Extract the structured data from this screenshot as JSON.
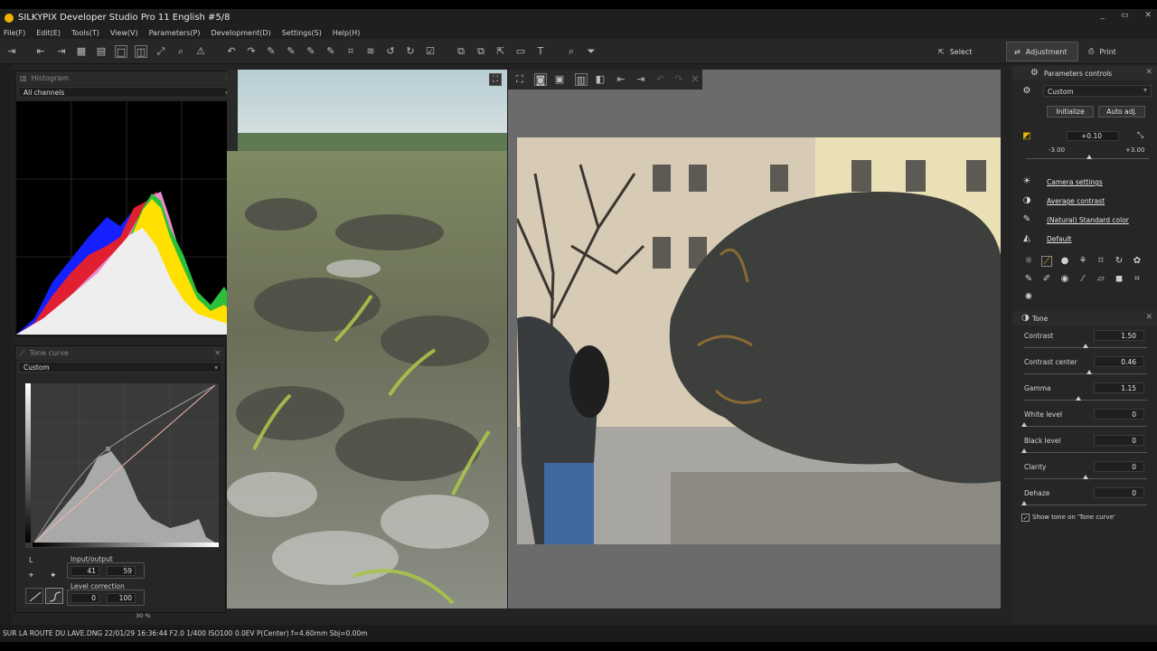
{
  "window": {
    "title": "SILKYPIX Developer Studio Pro 11 English   #5/8",
    "minimize": "_",
    "restore": "▭",
    "close": "✕"
  },
  "menu": [
    {
      "label": "File(F)"
    },
    {
      "label": "Edit(E)"
    },
    {
      "label": "Tools(T)"
    },
    {
      "label": "View(V)"
    },
    {
      "label": "Parameters(P)"
    },
    {
      "label": "Development(D)"
    },
    {
      "label": "Settings(S)"
    },
    {
      "label": "Help(H)"
    }
  ],
  "toolbar": {
    "select_label": "Select",
    "adjustment_label": "Adjustment",
    "print_label": "Print"
  },
  "histogram": {
    "title": "Histogram",
    "channel": "All channels"
  },
  "tone_curve": {
    "title": "Tone curve",
    "preset": "Custom",
    "channel": "L",
    "io_label": "Input/output",
    "input": "41",
    "output": "59",
    "level_label": "Level correction",
    "level_low": "0",
    "level_high": "100"
  },
  "zoom": {
    "value": "30",
    "unit": "%"
  },
  "params": {
    "title": "Parameters controls",
    "preset": "Custom",
    "initialize_label": "Initialize",
    "auto_label": "Auto adj.",
    "exposure": {
      "value": "+0.10",
      "min": "-3.00",
      "max": "+3.00",
      "fraction": 0.517
    },
    "camera_settings": "Camera settings",
    "contrast_preset": "Average contrast",
    "color_preset": "(Natural) Standard color",
    "sharpness_preset": "Default"
  },
  "tone": {
    "title": "Tone",
    "sliders": [
      {
        "label": "Contrast",
        "value": "1.50",
        "fraction": 0.5
      },
      {
        "label": "Contrast center",
        "value": "0.46",
        "fraction": 0.53
      },
      {
        "label": "Gamma",
        "value": "1.15",
        "fraction": 0.44
      },
      {
        "label": "White level",
        "value": "0",
        "fraction": 0.0
      },
      {
        "label": "Black level",
        "value": "0",
        "fraction": 0.0
      },
      {
        "label": "Clarity",
        "value": "0",
        "fraction": 0.5
      },
      {
        "label": "Dehaze",
        "value": "0",
        "fraction": 0.0
      }
    ],
    "show_tone_label": "Show tone on 'Tone curve'"
  },
  "status": {
    "text": "SUR LA ROUTE DU LAVE.DNG 22/01/29 16:36:44 F2.0 1/400 ISO100  0.0EV P(Center) f=4.60mm Sbj=0.00m"
  },
  "colors": {
    "accent": "#f0b400",
    "panel": "#262626",
    "viewer": "#6b6b6b"
  }
}
